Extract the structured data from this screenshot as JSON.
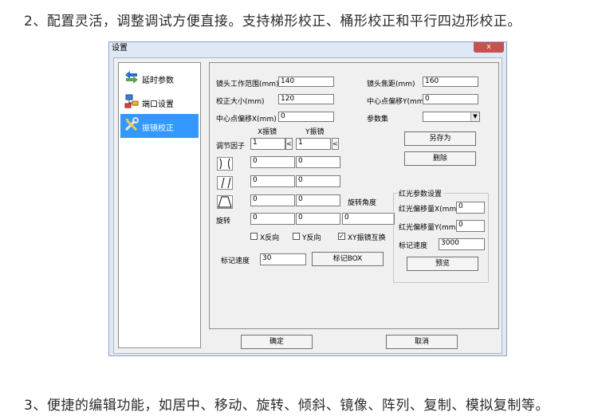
{
  "captions": {
    "top": "2、配置灵活，调整调试方便直接。支持梯形校正、桶形校正和平行四边形校正。",
    "bottom": "3、便捷的编辑功能，如居中、移动、旋转、倾斜、镜像、阵列、复制、模拟复制等。"
  },
  "window": {
    "title": "设置",
    "close_label": "x"
  },
  "nav": {
    "items": [
      {
        "label": "延时参数",
        "icon": "arrows-icon"
      },
      {
        "label": "端口设置",
        "icon": "network-icon"
      },
      {
        "label": "振镜校正",
        "icon": "tools-icon",
        "selected": true
      }
    ]
  },
  "form": {
    "lens_range_label": "镜头工作范围(mm)",
    "lens_range": "140",
    "lens_focal_label": "镜头焦距(mm)",
    "lens_focal": "160",
    "calib_size_label": "校正大小(mm)",
    "calib_size": "120",
    "center_offset_y_label": "中心点偏移Y(mm)",
    "center_offset_y": "0",
    "center_offset_x_label": "中心点偏移X(mm)",
    "center_offset_x": "0",
    "param_set_label": "参数集",
    "param_set_value": "",
    "x_galvo_header": "X振镜",
    "y_galvo_header": "Y振镜",
    "adjust_factor_label": "调节因子",
    "adjust_x": "1",
    "adjust_y": "1",
    "barrel_x": "0",
    "barrel_y": "0",
    "parallelogram_x": "0",
    "parallelogram_y": "0",
    "trapezoid_x": "0",
    "trapezoid_y": "0",
    "rotation_angle_label": "旋转角度",
    "rotate_label": "旋转",
    "rotate_x": "0",
    "rotate_y": "0",
    "rotation_angle": "0",
    "x_reverse_label": "X反向",
    "x_reverse": false,
    "y_reverse_label": "Y反向",
    "y_reverse": false,
    "xy_swap_label": "XY振镜互换",
    "xy_swap": true,
    "mark_speed_label": "标记速度",
    "mark_speed": "30",
    "mark_box_label": "标记BOX",
    "save_as_label": "另存为",
    "delete_label": "删除"
  },
  "red_light": {
    "group_title": "红光参数设置",
    "offset_x_label": "红光偏移量X(mm)",
    "offset_x": "0",
    "offset_y_label": "红光偏移量Y(mm)",
    "offset_y": "0",
    "mark_speed_label": "标记速度",
    "mark_speed": "3000",
    "preview_label": "预览"
  },
  "footer": {
    "ok_label": "确定",
    "cancel_label": "取消"
  },
  "colors": {
    "selection": "#3399ff",
    "close": "#c75050",
    "window_frame": "#dfe8f5"
  }
}
